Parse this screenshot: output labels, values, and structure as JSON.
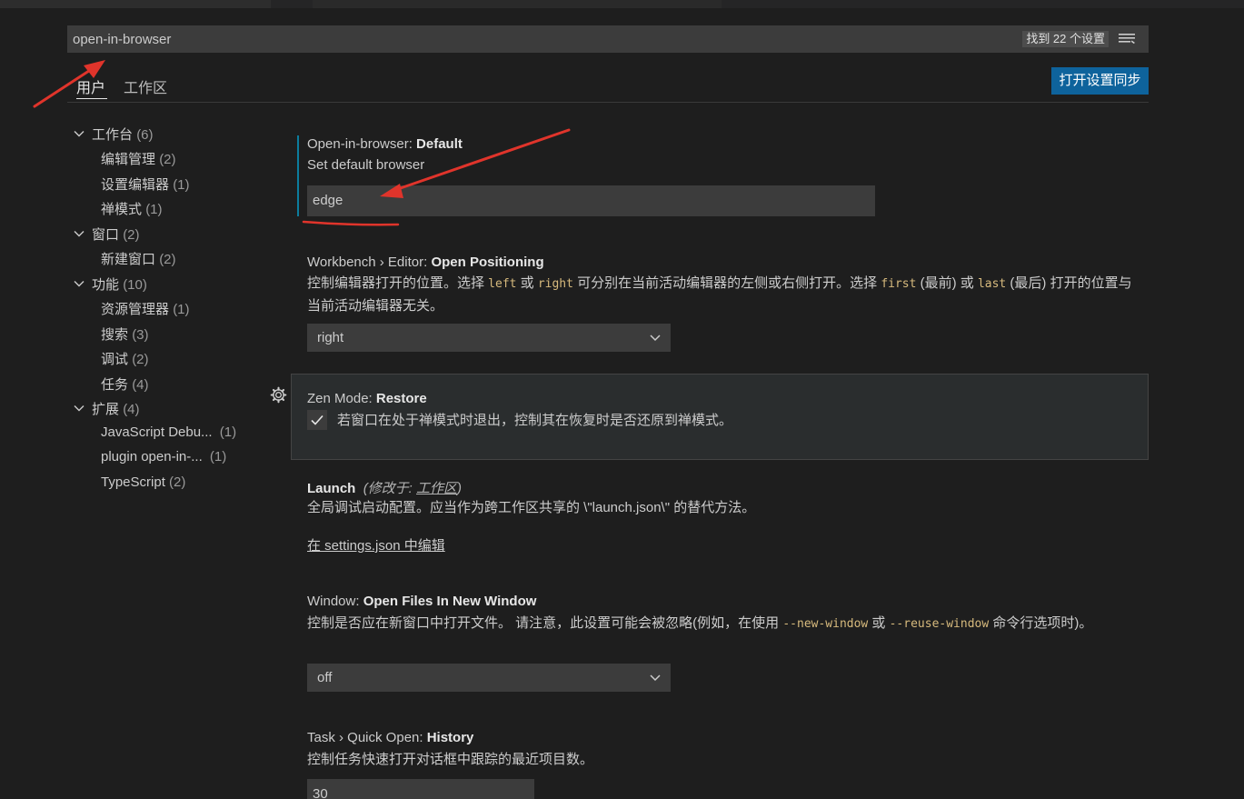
{
  "search": {
    "value": "open-in-browser",
    "count": "找到 22 个设置",
    "filter_icon": "filter-lines-icon"
  },
  "scope_tabs": {
    "user": "用户",
    "workspace": "工作区"
  },
  "sync_button": "打开设置同步",
  "toc": [
    {
      "label": "工作台",
      "count": "(6)",
      "expanded": true,
      "level": 0
    },
    {
      "label": "编辑管理",
      "count": "(2)",
      "level": 1
    },
    {
      "label": "设置编辑器",
      "count": "(1)",
      "level": 1
    },
    {
      "label": "禅模式",
      "count": "(1)",
      "level": 1
    },
    {
      "label": "窗口",
      "count": "(2)",
      "expanded": true,
      "level": 0
    },
    {
      "label": "新建窗口",
      "count": "(2)",
      "level": 1
    },
    {
      "label": "功能",
      "count": "(10)",
      "expanded": true,
      "level": 0
    },
    {
      "label": "资源管理器",
      "count": "(1)",
      "level": 1
    },
    {
      "label": "搜索",
      "count": "(3)",
      "level": 1
    },
    {
      "label": "调试",
      "count": "(2)",
      "level": 1
    },
    {
      "label": "任务",
      "count": "(4)",
      "level": 1
    },
    {
      "label": "扩展",
      "count": "(4)",
      "expanded": true,
      "level": 0
    },
    {
      "label": "JavaScript Debu...",
      "count": "(1)",
      "level": 1
    },
    {
      "label": "plugin open-in-...",
      "count": "(1)",
      "level": 1
    },
    {
      "label": "TypeScript",
      "count": "(2)",
      "level": 1
    }
  ],
  "settings": {
    "open_in_browser": {
      "category": "Open-in-browser: ",
      "name": "Default",
      "description": "Set default browser",
      "value": "edge"
    },
    "open_positioning": {
      "category": "Workbench › Editor: ",
      "name": "Open Positioning",
      "desc_1": "控制编辑器打开的位置。选择 ",
      "code_1": "left",
      "desc_2": " 或 ",
      "code_2": "right",
      "desc_3": " 可分别在当前活动编辑器的左侧或右侧打开。选择 ",
      "code_3": "first",
      "desc_4": " (最前) 或 ",
      "code_4": "last",
      "desc_5": " (最后) 打开的位置与当前活动编辑器无关。",
      "value": "right"
    },
    "zen_restore": {
      "category": "Zen Mode: ",
      "name": "Restore",
      "description": "若窗口在处于禅模式时退出，控制其在恢复时是否还原到禅模式。",
      "checked": true
    },
    "launch": {
      "name": "Launch",
      "modified_prefix": "(修改于: ",
      "modified_link": "工作区",
      "modified_suffix": ")",
      "description": "全局调试启动配置。应当作为跨工作区共享的 \\\"launch.json\\\" 的替代方法。",
      "edit_link": "在 settings.json 中编辑"
    },
    "open_files_new_window": {
      "category": "Window: ",
      "name": "Open Files In New Window",
      "desc_1": "控制是否应在新窗口中打开文件。 请注意，此设置可能会被忽略(例如，在使用 ",
      "code_1": "--new-window",
      "desc_2": " 或 ",
      "code_2": "--reuse-window",
      "desc_3": " 命令行选项时)。",
      "value": "off"
    },
    "quick_open_history": {
      "category": "Task › Quick Open: ",
      "name": "History",
      "description": "控制任务快速打开对话框中跟踪的最近项目数。",
      "value": "30"
    }
  },
  "icons": {
    "gear": "gear-icon",
    "chevron": "chevron-down-icon",
    "check": "check-icon"
  },
  "annotations": {
    "arrow_color": "#e0342b"
  }
}
